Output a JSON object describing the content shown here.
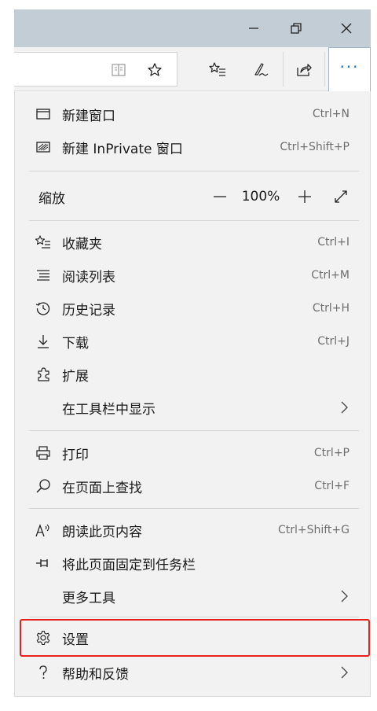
{
  "window": {
    "minimize_icon": "minimize-icon",
    "restore_icon": "restore-icon",
    "close_icon": "close-icon"
  },
  "toolbar": {
    "address_icons": [
      "reading-view-icon",
      "add-favorite-star-icon"
    ],
    "buttons": [
      "favorites-icon",
      "web-note-icon",
      "share-icon",
      "more-icon"
    ],
    "more_label": "···"
  },
  "menu": {
    "new_window": {
      "label": "新建窗口",
      "shortcut": "Ctrl+N",
      "icon": "window-icon"
    },
    "new_inprivate": {
      "label": "新建 InPrivate 窗口",
      "shortcut": "Ctrl+Shift+P",
      "icon": "inprivate-icon"
    },
    "zoom": {
      "label": "缩放",
      "value": "100%",
      "icons": [
        "zoom-out-icon",
        "zoom-in-icon",
        "fullscreen-icon"
      ]
    },
    "favorites": {
      "label": "收藏夹",
      "shortcut": "Ctrl+I",
      "icon": "favorites-icon"
    },
    "reading_list": {
      "label": "阅读列表",
      "shortcut": "Ctrl+M",
      "icon": "reading-list-icon"
    },
    "history": {
      "label": "历史记录",
      "shortcut": "Ctrl+H",
      "icon": "history-icon"
    },
    "downloads": {
      "label": "下载",
      "shortcut": "Ctrl+J",
      "icon": "download-icon"
    },
    "extensions": {
      "label": "扩展",
      "icon": "extensions-icon"
    },
    "show_in_toolbar": {
      "label": "在工具栏中显示",
      "icon": "chevron-right-icon"
    },
    "print": {
      "label": "打印",
      "shortcut": "Ctrl+P",
      "icon": "printer-icon"
    },
    "find": {
      "label": "在页面上查找",
      "shortcut": "Ctrl+F",
      "icon": "search-icon"
    },
    "read_aloud": {
      "label": "朗读此页内容",
      "shortcut": "Ctrl+Shift+G",
      "icon": "read-aloud-icon"
    },
    "pin_taskbar": {
      "label": "将此页面固定到任务栏",
      "icon": "pin-icon"
    },
    "more_tools": {
      "label": "更多工具",
      "icon": "chevron-right-icon"
    },
    "settings": {
      "label": "设置",
      "icon": "gear-icon"
    },
    "help": {
      "label": "帮助和反馈",
      "icon": "help-icon"
    }
  },
  "colors": {
    "titlebar": "#c3cdd6",
    "menu_bg": "#f2f2f2",
    "accent": "#1a6fc4",
    "highlight_border": "#e8201c"
  }
}
